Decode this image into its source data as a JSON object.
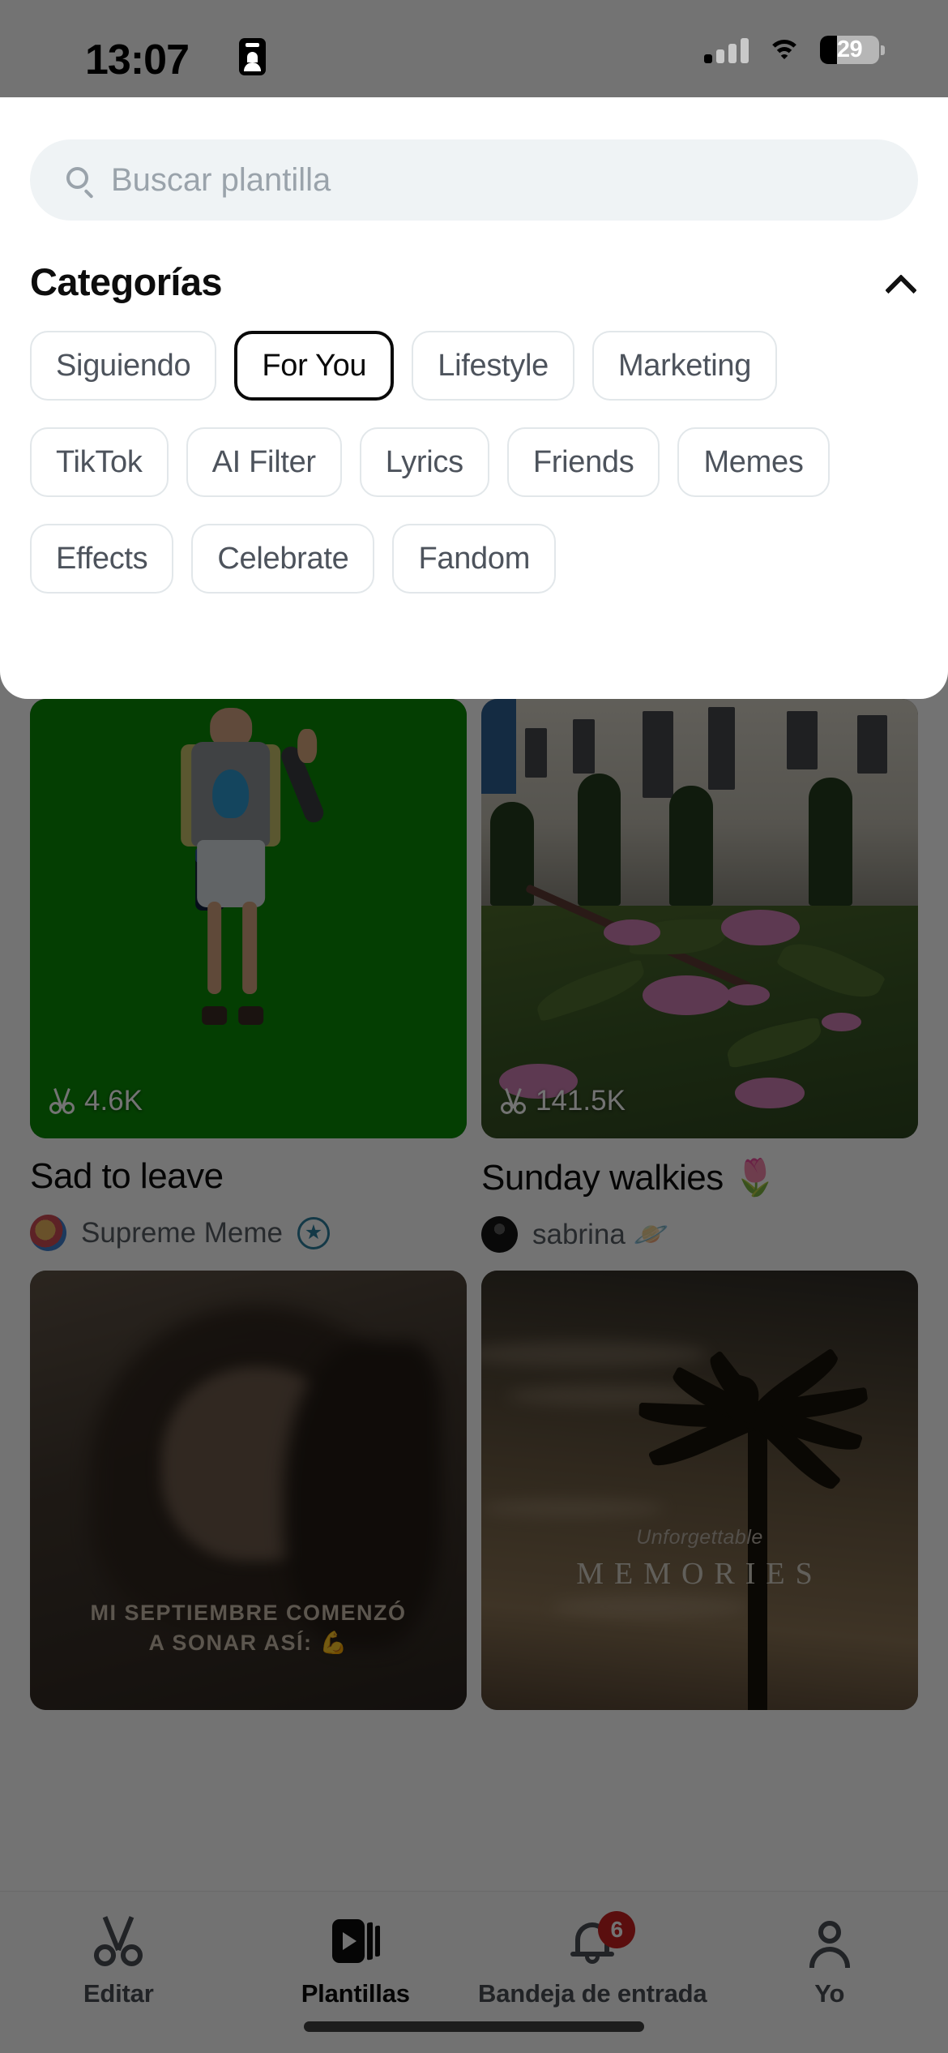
{
  "status_bar": {
    "time": "13:07",
    "face_id_icon": "face-id-icon",
    "signal_icon": "cellular-signal-icon",
    "signal_bars_filled": 1,
    "signal_bars_total": 4,
    "wifi_icon": "wifi-icon",
    "battery_icon": "battery-icon",
    "battery_percent": "29"
  },
  "search": {
    "placeholder": "Buscar plantilla",
    "value": "",
    "icon": "search-icon"
  },
  "categories_panel": {
    "title": "Categorías",
    "collapse_icon": "chevron-up-icon",
    "chips": [
      {
        "label": "Siguiendo",
        "selected": false
      },
      {
        "label": "For You",
        "selected": true
      },
      {
        "label": "Lifestyle",
        "selected": false
      },
      {
        "label": "Marketing",
        "selected": false
      },
      {
        "label": "TikTok",
        "selected": false
      },
      {
        "label": "AI Filter",
        "selected": false
      },
      {
        "label": "Lyrics",
        "selected": false
      },
      {
        "label": "Friends",
        "selected": false
      },
      {
        "label": "Memes",
        "selected": false
      },
      {
        "label": "Effects",
        "selected": false
      },
      {
        "label": "Celebrate",
        "selected": false
      },
      {
        "label": "Fandom",
        "selected": false
      }
    ]
  },
  "templates": [
    {
      "title": "Sad to leave",
      "author": "Supreme Meme",
      "uses": "4.6K",
      "uses_icon": "scissors-icon",
      "verified": true,
      "verified_icon": "verified-star-icon",
      "avatar": "ok-hand-avatar",
      "thumb": "green-screen-kid-suitcase"
    },
    {
      "title": "Sunday walkies 🌷",
      "author": "sabrina 🪐",
      "uses": "141.5K",
      "uses_icon": "scissors-icon",
      "verified": false,
      "avatar": "dark-portrait-avatar",
      "thumb": "building-and-cherry-blossoms"
    },
    {
      "title": "",
      "author": "",
      "uses": "",
      "thumb": "portrait-overlay-text",
      "overlay_text": "MI SEPTIEMBRE COMENZÓ\nA SONAR ASÍ: 💪"
    },
    {
      "title": "",
      "author": "",
      "uses": "",
      "thumb": "palm-tree-silhouette",
      "overlay_subtitle": "Unforgettable",
      "overlay_title": "MEMORIES"
    }
  ],
  "tab_bar": [
    {
      "label": "Editar",
      "icon": "scissors-icon",
      "active": false,
      "badge": ""
    },
    {
      "label": "Plantillas",
      "icon": "templates-icon",
      "active": true,
      "badge": ""
    },
    {
      "label": "Bandeja de entrada",
      "icon": "bell-icon",
      "active": false,
      "badge": "6"
    },
    {
      "label": "Yo",
      "icon": "person-icon",
      "active": false,
      "badge": ""
    }
  ],
  "colors": {
    "accent_selected": "#0a0a0a",
    "chip_border": "#e2e7ea",
    "search_bg": "#eff3f5",
    "badge_red": "#c72020",
    "verified_teal": "#2d7f9e",
    "green_screen": "#0a8a06"
  }
}
